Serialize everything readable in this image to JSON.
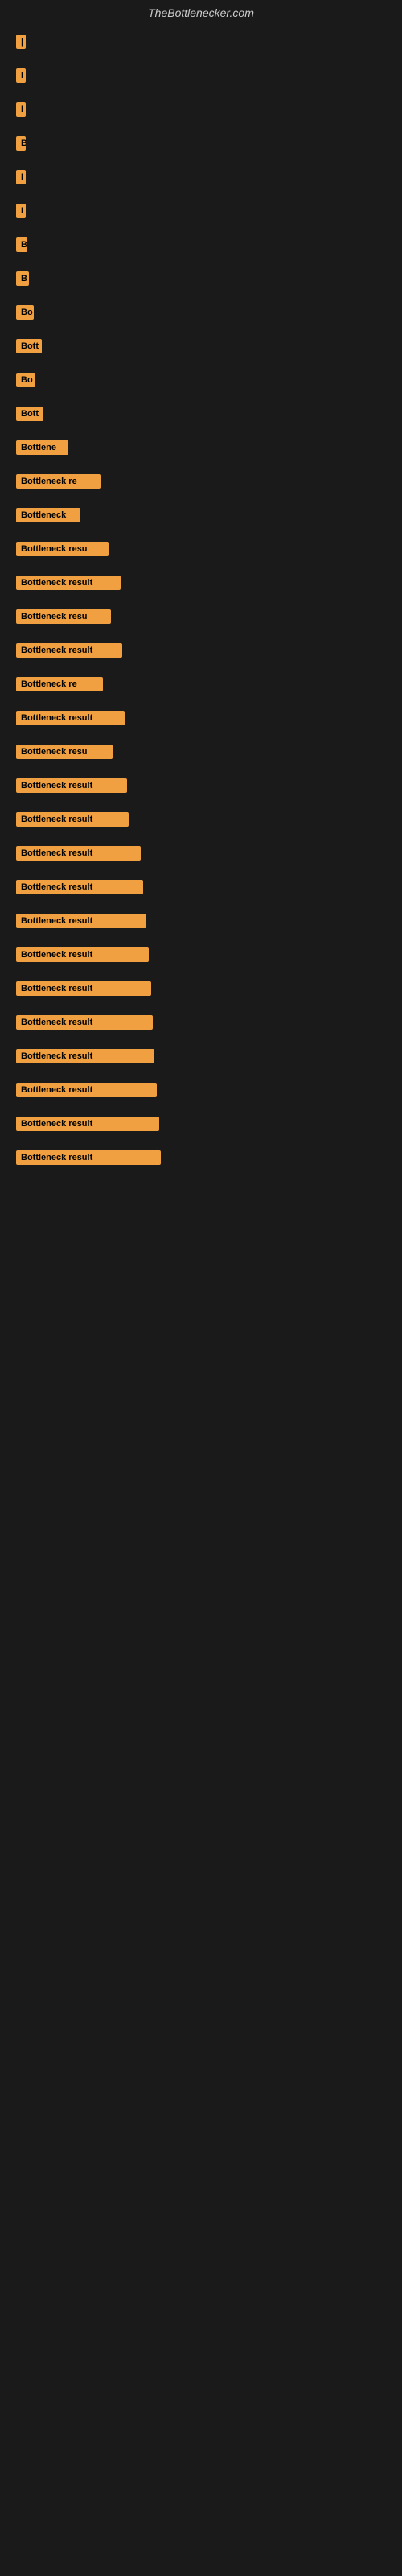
{
  "site": {
    "title": "TheBottlenecker.com"
  },
  "bars": [
    {
      "id": 1,
      "label": "|",
      "width": 8
    },
    {
      "id": 2,
      "label": "I",
      "width": 10
    },
    {
      "id": 3,
      "label": "I",
      "width": 10
    },
    {
      "id": 4,
      "label": "B",
      "width": 12
    },
    {
      "id": 5,
      "label": "I",
      "width": 10
    },
    {
      "id": 6,
      "label": "I",
      "width": 10
    },
    {
      "id": 7,
      "label": "B",
      "width": 14
    },
    {
      "id": 8,
      "label": "B",
      "width": 16
    },
    {
      "id": 9,
      "label": "Bo",
      "width": 22
    },
    {
      "id": 10,
      "label": "Bott",
      "width": 32
    },
    {
      "id": 11,
      "label": "Bo",
      "width": 24
    },
    {
      "id": 12,
      "label": "Bott",
      "width": 34
    },
    {
      "id": 13,
      "label": "Bottlene",
      "width": 65
    },
    {
      "id": 14,
      "label": "Bottleneck re",
      "width": 105
    },
    {
      "id": 15,
      "label": "Bottleneck",
      "width": 80
    },
    {
      "id": 16,
      "label": "Bottleneck resu",
      "width": 115
    },
    {
      "id": 17,
      "label": "Bottleneck result",
      "width": 130
    },
    {
      "id": 18,
      "label": "Bottleneck resu",
      "width": 118
    },
    {
      "id": 19,
      "label": "Bottleneck result",
      "width": 132
    },
    {
      "id": 20,
      "label": "Bottleneck re",
      "width": 108
    },
    {
      "id": 21,
      "label": "Bottleneck result",
      "width": 135
    },
    {
      "id": 22,
      "label": "Bottleneck resu",
      "width": 120
    },
    {
      "id": 23,
      "label": "Bottleneck result",
      "width": 138
    },
    {
      "id": 24,
      "label": "Bottleneck result",
      "width": 140
    },
    {
      "id": 25,
      "label": "Bottleneck result",
      "width": 155
    },
    {
      "id": 26,
      "label": "Bottleneck result",
      "width": 158
    },
    {
      "id": 27,
      "label": "Bottleneck result",
      "width": 162
    },
    {
      "id": 28,
      "label": "Bottleneck result",
      "width": 165
    },
    {
      "id": 29,
      "label": "Bottleneck result",
      "width": 168
    },
    {
      "id": 30,
      "label": "Bottleneck result",
      "width": 170
    },
    {
      "id": 31,
      "label": "Bottleneck result",
      "width": 172
    },
    {
      "id": 32,
      "label": "Bottleneck result",
      "width": 175
    },
    {
      "id": 33,
      "label": "Bottleneck result",
      "width": 178
    },
    {
      "id": 34,
      "label": "Bottleneck result",
      "width": 180
    }
  ]
}
